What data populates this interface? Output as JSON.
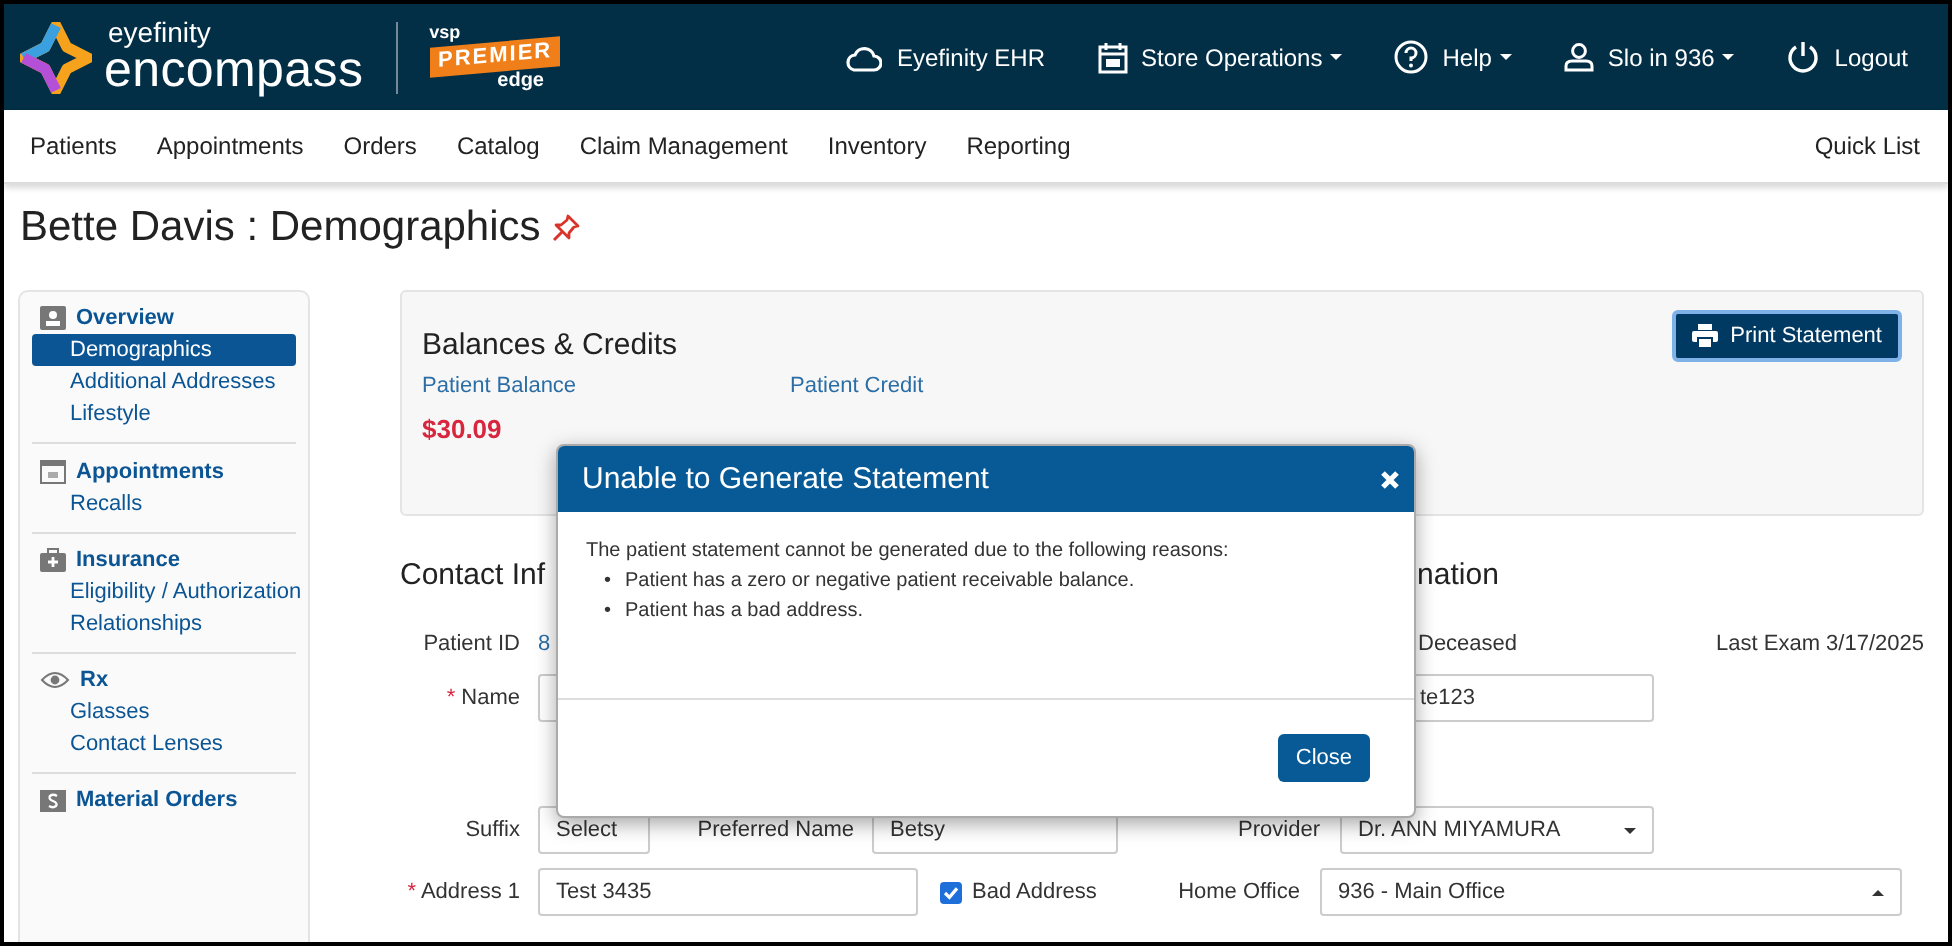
{
  "header": {
    "logo": {
      "top": "eyefinity",
      "main": "encompass",
      "partner_top": "vsp",
      "partner_badge": "PREMIER",
      "partner_bottom": "edge"
    },
    "menu": [
      {
        "label": "Eyefinity EHR",
        "has_menu": false
      },
      {
        "label": "Store Operations",
        "has_menu": true
      },
      {
        "label": "Help",
        "has_menu": true
      },
      {
        "label": "Slo in 936",
        "has_menu": true
      },
      {
        "label": "Logout",
        "has_menu": false
      }
    ]
  },
  "nav": {
    "items": [
      "Patients",
      "Appointments",
      "Orders",
      "Catalog",
      "Claim Management",
      "Inventory",
      "Reporting"
    ],
    "quick_list": "Quick List"
  },
  "page_title": "Bette Davis : Demographics",
  "sidebar": {
    "sections": [
      {
        "title": "Overview",
        "items": [
          {
            "label": "Demographics",
            "selected": true
          },
          {
            "label": "Additional Addresses",
            "selected": false
          },
          {
            "label": "Lifestyle",
            "selected": false
          }
        ]
      },
      {
        "title": "Appointments",
        "items": [
          {
            "label": "Recalls",
            "selected": false
          }
        ]
      },
      {
        "title": "Insurance",
        "items": [
          {
            "label": "Eligibility / Authorization",
            "selected": false
          },
          {
            "label": "Relationships",
            "selected": false
          }
        ]
      },
      {
        "title": "Rx",
        "items": [
          {
            "label": "Glasses",
            "selected": false
          },
          {
            "label": "Contact Lenses",
            "selected": false
          }
        ]
      },
      {
        "title": "Material Orders"
      }
    ]
  },
  "balances": {
    "title": "Balances & Credits",
    "print_button": "Print Statement",
    "balance_label": "Patient Balance",
    "balance_value": "$30.09",
    "credit_label": "Patient Credit"
  },
  "contact": {
    "heading_left": "Contact Inf",
    "heading_right": "nation",
    "patient_id": {
      "label": "Patient ID",
      "value": "8"
    },
    "deceased": {
      "label": "Deceased"
    },
    "last_exam": "Last Exam 3/17/2025",
    "name": {
      "label": "Name",
      "required_mark": "*"
    },
    "second_field": {
      "value": "te123"
    },
    "suffix": {
      "label": "Suffix",
      "value": "Select"
    },
    "preferred_name": {
      "label": "Preferred Name",
      "value": "Betsy"
    },
    "provider": {
      "label": "Provider",
      "value": "Dr. ANN MIYAMURA"
    },
    "address1": {
      "label": "Address 1",
      "required_mark": "*",
      "value": "Test 3435"
    },
    "bad_address": {
      "label": "Bad Address",
      "checked": true
    },
    "home_office": {
      "label": "Home Office",
      "value": "936 - Main Office"
    }
  },
  "modal": {
    "title": "Unable to Generate Statement",
    "message": "The patient statement cannot be generated due to the following reasons:",
    "reasons": [
      {
        "bullet": "•",
        "text": "Patient has a zero or negative patient receivable balance."
      },
      {
        "bullet": "•",
        "text": "Patient has a bad address."
      }
    ],
    "close_button": "Close"
  }
}
